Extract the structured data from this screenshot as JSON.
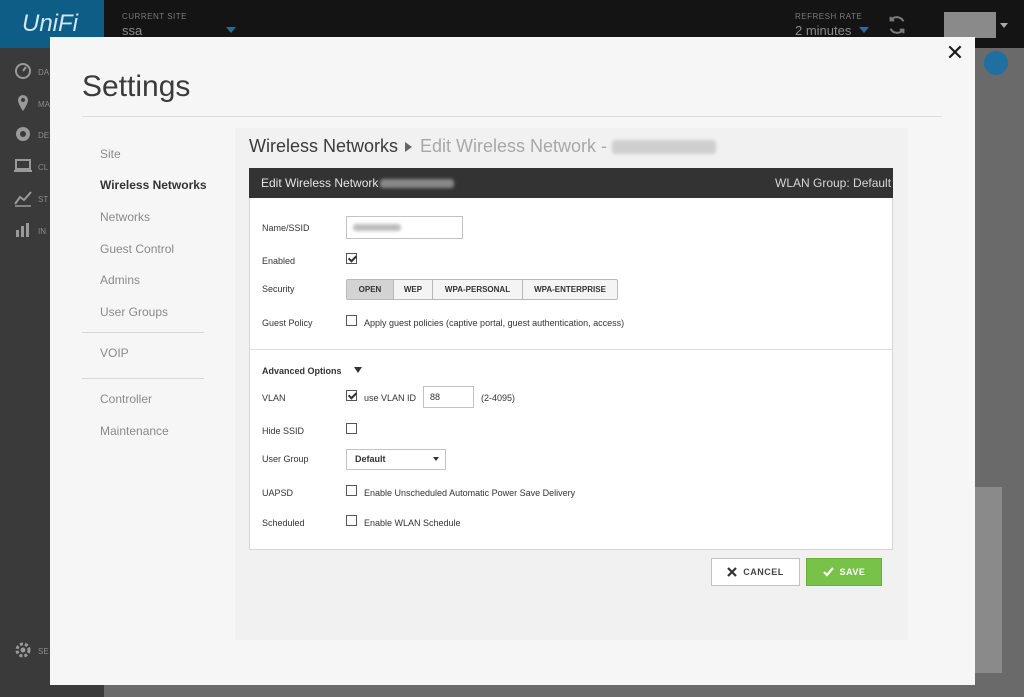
{
  "app": {
    "brand": "UniFi",
    "site_label": "CURRENT SITE",
    "site_value": "ssa",
    "refresh_label": "REFRESH RATE",
    "refresh_value": "2 minutes",
    "nav": [
      {
        "icon": "dashboard-icon",
        "label": "DA"
      },
      {
        "icon": "map-icon",
        "label": "MA"
      },
      {
        "icon": "devices-icon",
        "label": "DE"
      },
      {
        "icon": "clients-icon",
        "label": "CL"
      },
      {
        "icon": "stats-icon",
        "label": "ST"
      },
      {
        "icon": "insights-icon",
        "label": "IN"
      },
      {
        "icon": "settings-icon",
        "label": "SE"
      }
    ]
  },
  "modal": {
    "title": "Settings",
    "close_icon": "close-icon"
  },
  "sidebar": {
    "items": [
      {
        "label": "Site",
        "active": false
      },
      {
        "label": "Wireless Networks",
        "active": true
      },
      {
        "label": "Networks",
        "active": false
      },
      {
        "label": "Guest Control",
        "active": false
      },
      {
        "label": "Admins",
        "active": false
      },
      {
        "label": "User Groups",
        "active": false
      },
      {
        "label": "VOIP",
        "active": false
      },
      {
        "label": "Controller",
        "active": false
      },
      {
        "label": "Maintenance",
        "active": false
      }
    ]
  },
  "breadcrumb": {
    "parent": "Wireless Networks",
    "current": "Edit Wireless Network -"
  },
  "panel": {
    "title": "Edit Wireless Network -",
    "wlan_group": "WLAN Group: Default"
  },
  "form": {
    "name_label": "Name/SSID",
    "enabled_label": "Enabled",
    "enabled_checked": true,
    "security_label": "Security",
    "security_options": [
      "OPEN",
      "WEP",
      "WPA-PERSONAL",
      "WPA-ENTERPRISE"
    ],
    "security_selected": "OPEN",
    "guest_policy_label": "Guest Policy",
    "guest_policy_text": "Apply guest policies (captive portal, guest authentication, access)",
    "guest_policy_checked": false,
    "advanced_label": "Advanced Options",
    "vlan_label": "VLAN",
    "vlan_checked": true,
    "vlan_checkbox_text": "use VLAN ID",
    "vlan_value": "88",
    "vlan_range": "(2-4095)",
    "hide_ssid_label": "Hide SSID",
    "hide_ssid_checked": false,
    "user_group_label": "User Group",
    "user_group_value": "Default",
    "uapsd_label": "UAPSD",
    "uapsd_text": "Enable Unscheduled Automatic Power Save Delivery",
    "uapsd_checked": false,
    "scheduled_label": "Scheduled",
    "scheduled_text": "Enable WLAN Schedule",
    "scheduled_checked": false
  },
  "buttons": {
    "cancel": "CANCEL",
    "save": "SAVE"
  },
  "colors": {
    "accent": "#1f6fa0",
    "save_green": "#78c24a",
    "panel_header": "#333333"
  }
}
